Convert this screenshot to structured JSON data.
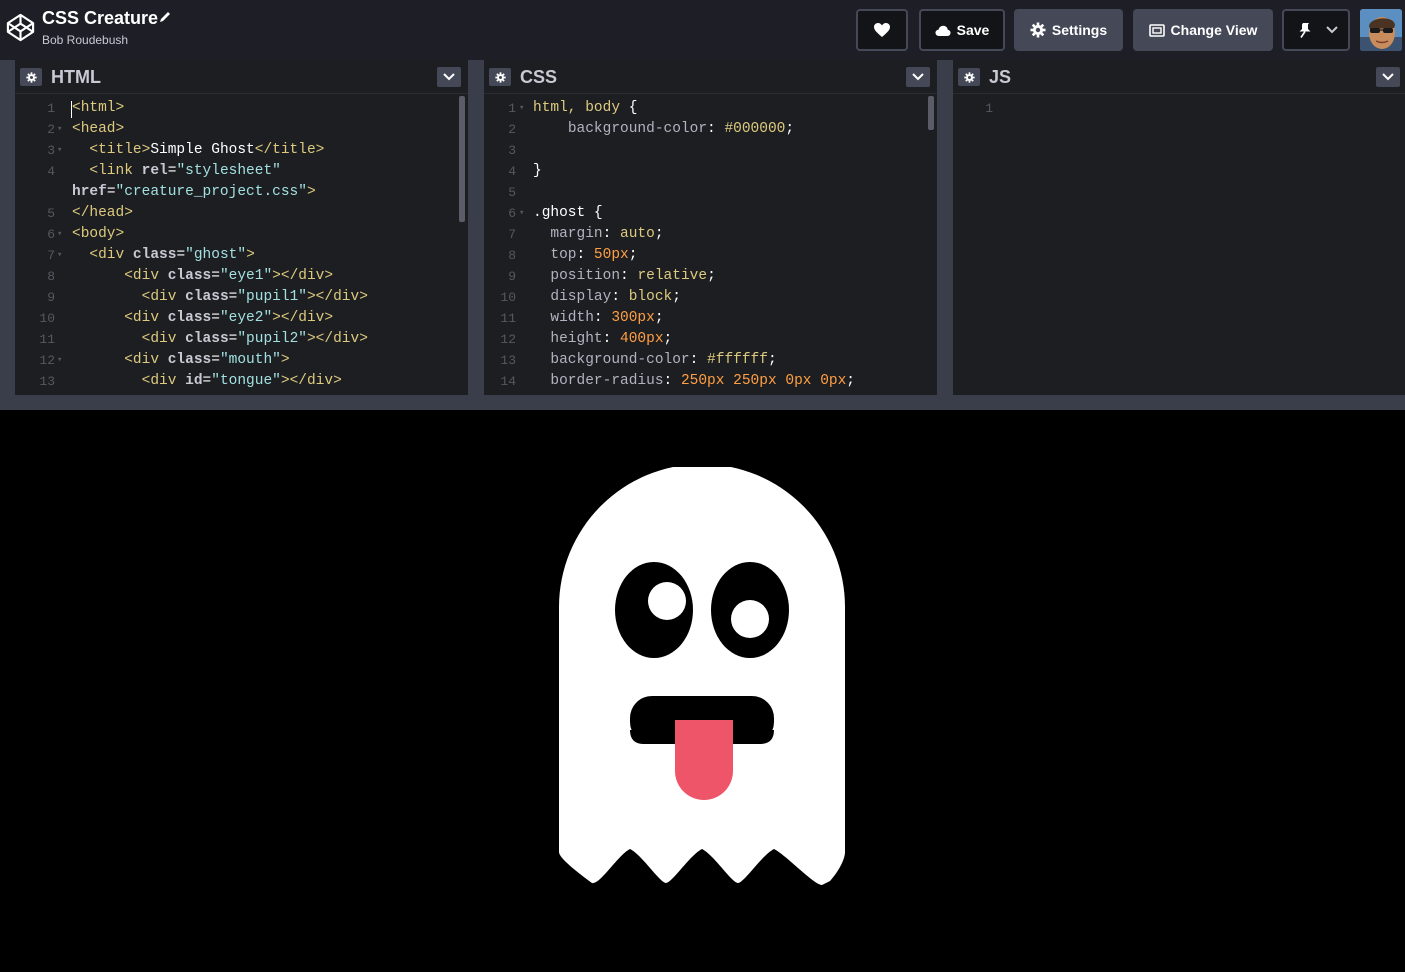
{
  "header": {
    "project_title": "CSS Creature",
    "author": "Bob Roudebush",
    "save_label": "Save",
    "settings_label": "Settings",
    "change_view_label": "Change View"
  },
  "panes": {
    "html": {
      "title": "HTML",
      "lines": [
        {
          "n": "1",
          "fold": false
        },
        {
          "n": "2",
          "fold": true
        },
        {
          "n": "3",
          "fold": true
        },
        {
          "n": "4",
          "fold": false
        },
        {
          "n": "",
          "fold": false
        },
        {
          "n": "5",
          "fold": false
        },
        {
          "n": "6",
          "fold": true
        },
        {
          "n": "7",
          "fold": true
        },
        {
          "n": "8",
          "fold": false
        },
        {
          "n": "9",
          "fold": false
        },
        {
          "n": "10",
          "fold": false
        },
        {
          "n": "11",
          "fold": false
        },
        {
          "n": "12",
          "fold": true
        },
        {
          "n": "13",
          "fold": false
        }
      ]
    },
    "css": {
      "title": "CSS",
      "lines": [
        {
          "n": "1",
          "fold": true
        },
        {
          "n": "2",
          "fold": false
        },
        {
          "n": "3",
          "fold": false
        },
        {
          "n": "4",
          "fold": false
        },
        {
          "n": "5",
          "fold": false
        },
        {
          "n": "6",
          "fold": true
        },
        {
          "n": "7",
          "fold": false
        },
        {
          "n": "8",
          "fold": false
        },
        {
          "n": "9",
          "fold": false
        },
        {
          "n": "10",
          "fold": false
        },
        {
          "n": "11",
          "fold": false
        },
        {
          "n": "12",
          "fold": false
        },
        {
          "n": "13",
          "fold": false
        },
        {
          "n": "14",
          "fold": false
        }
      ]
    },
    "js": {
      "title": "JS",
      "lines": [
        {
          "n": "1",
          "fold": false
        }
      ]
    }
  },
  "code": {
    "html": {
      "l1": "html",
      "l2": "head",
      "l3_open": "title",
      "l3_text": "Simple Ghost",
      "l3_close": "/title",
      "l4_tag": "link",
      "l4_attr": "rel",
      "l4_val": "\"stylesheet\"",
      "l4b_attr": "href",
      "l4b_val": "\"creature_project.css\"",
      "l5": "/head",
      "l6": "body",
      "l7_val": "\"ghost\"",
      "l8_val": "\"eye1\"",
      "l9_val": "\"pupil1\"",
      "l10_val": "\"eye2\"",
      "l11_val": "\"pupil2\"",
      "l12_val": "\"mouth\"",
      "l13_val": "\"tongue\"",
      "div": "div",
      "div_close": "/div",
      "class": "class",
      "id": "id"
    },
    "css": {
      "l1_sel": "html, body",
      "l2_prop": "background-color",
      "l2_val": "#000000",
      "l6_sel": ".ghost",
      "l7_prop": "margin",
      "l7_val": "auto",
      "l8_prop": "top",
      "l8_val": "50px",
      "l9_prop": "position",
      "l9_val": "relative",
      "l10_prop": "display",
      "l10_val": "block",
      "l11_prop": "width",
      "l11_val": "300px",
      "l12_prop": "height",
      "l12_val": "400px",
      "l13_prop": "background-color",
      "l13_val": "#ffffff",
      "l14_prop": "border-radius",
      "l14_v1": "250px",
      "l14_v2": "250px",
      "l14_v3": "0px",
      "l14_v4": "0px"
    }
  },
  "preview": {
    "ghost_color": "#ffffff",
    "tongue_color": "#ef5569",
    "background": "#000000"
  }
}
